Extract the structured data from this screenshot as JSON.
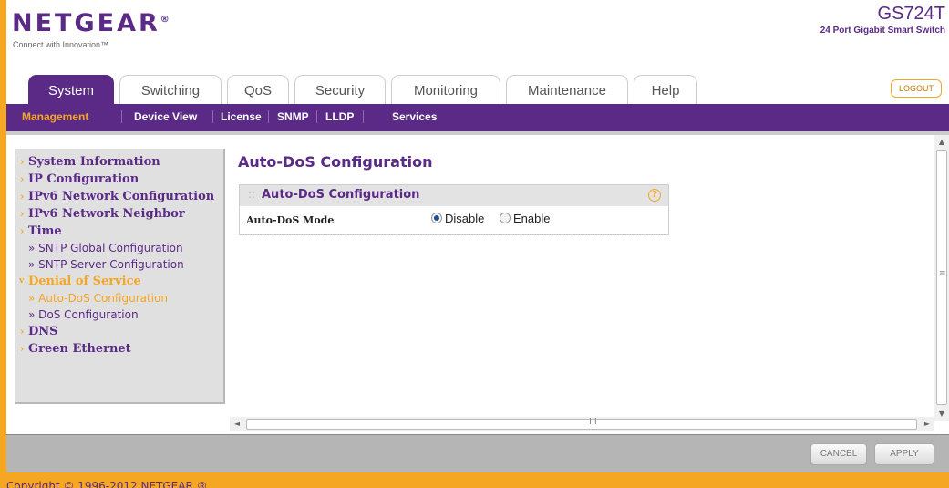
{
  "header": {
    "logo_text": "NETGEAR",
    "logo_mark": "®",
    "tagline": "Connect with Innovation™",
    "model": "GS724T",
    "model_desc": "24 Port Gigabit Smart Switch"
  },
  "tabs": [
    {
      "label": "System",
      "active": true
    },
    {
      "label": "Switching"
    },
    {
      "label": "QoS"
    },
    {
      "label": "Security"
    },
    {
      "label": "Monitoring"
    },
    {
      "label": "Maintenance"
    },
    {
      "label": "Help"
    }
  ],
  "logout_label": "LOGOUT",
  "subnav": [
    {
      "label": "Management",
      "active": true
    },
    {
      "label": "Device View"
    },
    {
      "label": "License"
    },
    {
      "label": "SNMP"
    },
    {
      "label": "LLDP"
    },
    {
      "label": "Services"
    }
  ],
  "sidebar": {
    "items": [
      {
        "label": "System Information"
      },
      {
        "label": "IP Configuration"
      },
      {
        "label": "IPv6 Network Configuration"
      },
      {
        "label": "IPv6 Network Neighbor"
      },
      {
        "label": "Time"
      },
      {
        "label": "» SNTP Global Configuration"
      },
      {
        "label": "» SNTP Server Configuration"
      },
      {
        "label": "Denial of Service"
      },
      {
        "label": "» Auto-DoS Configuration"
      },
      {
        "label": "» DoS Configuration"
      },
      {
        "label": "DNS"
      },
      {
        "label": "Green Ethernet"
      }
    ]
  },
  "main": {
    "page_title": "Auto-DoS Configuration",
    "panel_title": "Auto-DoS Configuration",
    "panel_grip": "::",
    "help_glyph": "?",
    "field_label": "Auto-DoS Mode",
    "options": [
      {
        "label": "Disable",
        "checked": true
      },
      {
        "label": "Enable",
        "checked": false
      }
    ]
  },
  "scroll": {
    "up_glyph": "▲",
    "down_glyph": "▼",
    "left_glyph": "◄",
    "right_glyph": "►",
    "v_grip": "≡",
    "h_grip": "III"
  },
  "footer": {
    "cancel_label": "CANCEL",
    "apply_label": "APPLY",
    "copyright": "Copyright © 1996-2012 NETGEAR ®"
  },
  "colors": {
    "brand_purple": "#5b2a86",
    "accent_orange": "#f5a623"
  }
}
